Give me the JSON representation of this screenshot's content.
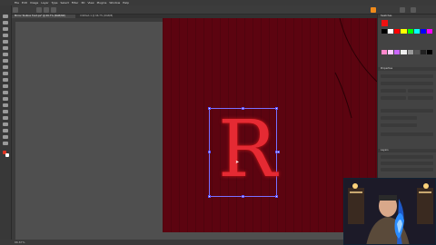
{
  "menubar": {
    "items": [
      "File",
      "Edit",
      "Image",
      "Layer",
      "Type",
      "Select",
      "Filter",
      "3D",
      "View",
      "Plugins",
      "Window",
      "Help"
    ]
  },
  "tabs": [
    {
      "label": "Mirror Toolbox front.ps* @ 66.7% (RGB/8#)"
    },
    {
      "label": "Untitled-1 @ 66.7% (RGB/8)"
    }
  ],
  "canvas": {
    "letter": "R",
    "colors": {
      "artboard": "#5c0410",
      "letter": "#e52a33",
      "selection": "#7a70ff"
    }
  },
  "panels": {
    "swatches_title": "Swatches",
    "properties_title": "Properties",
    "layers_title": "Layers"
  },
  "status": {
    "zoom": "66.67%"
  },
  "webcam": {
    "label": "presenter webcam"
  }
}
